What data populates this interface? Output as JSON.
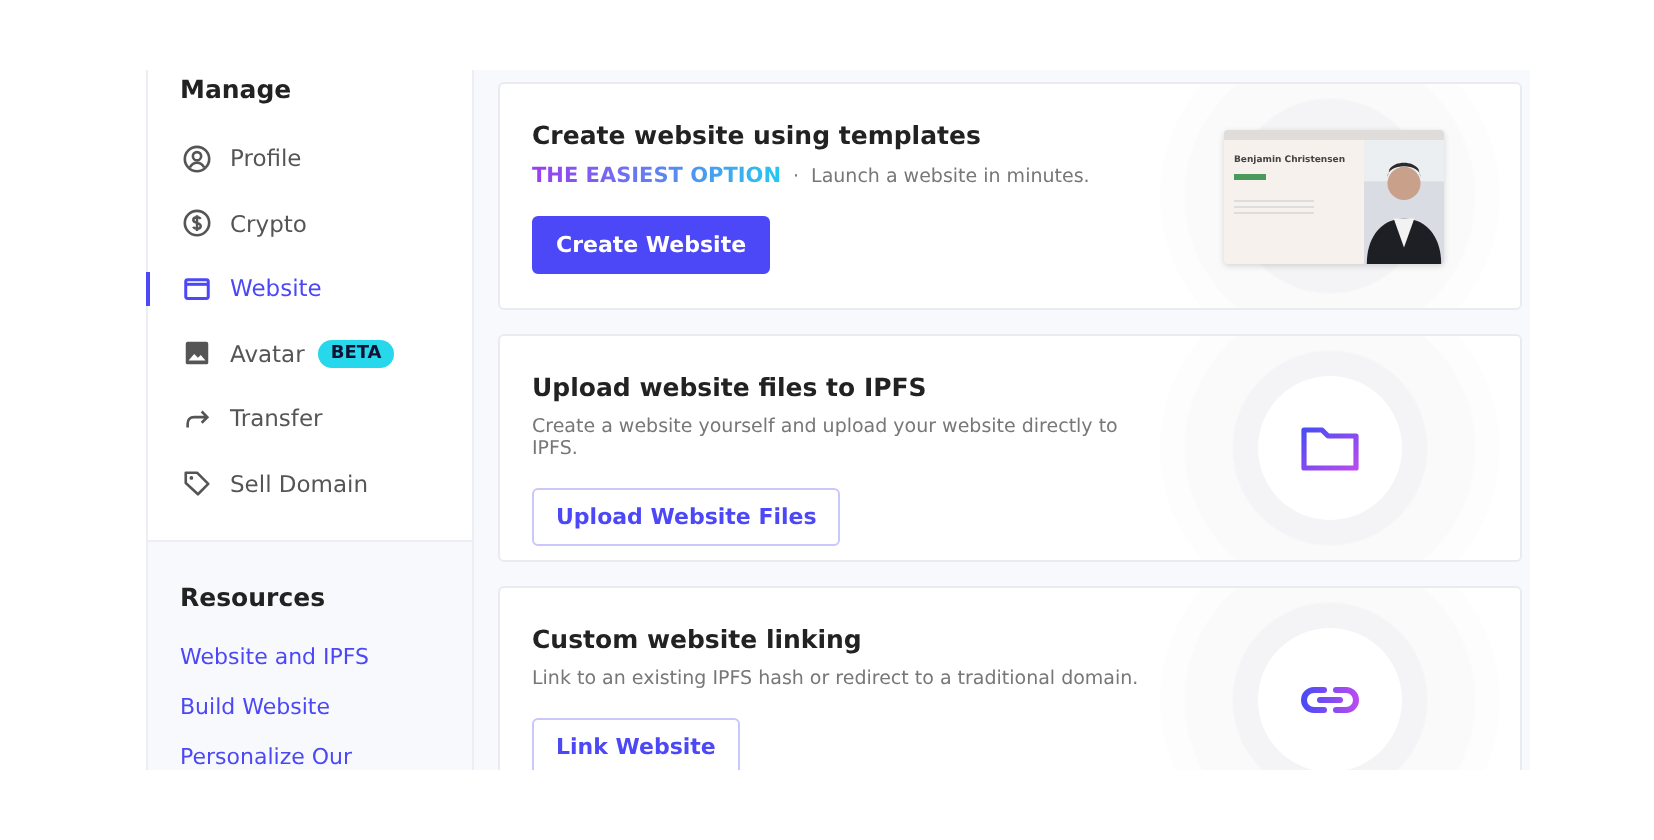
{
  "sidebar": {
    "heading": "Manage",
    "items": [
      {
        "label": "Profile",
        "selected": false
      },
      {
        "label": "Crypto",
        "selected": false
      },
      {
        "label": "Website",
        "selected": true
      },
      {
        "label": "Avatar",
        "selected": false,
        "badge": "BETA"
      },
      {
        "label": "Transfer",
        "selected": false
      },
      {
        "label": "Sell Domain",
        "selected": false
      }
    ],
    "resources": {
      "heading": "Resources",
      "links": [
        "Website and IPFS",
        "Build Website",
        "Personalize Our"
      ]
    }
  },
  "cards": [
    {
      "kind": "preview",
      "title": "Create website using templates",
      "tag": "THE EASIEST OPTION",
      "separator": "·",
      "description": "Launch a website in minutes.",
      "button": "Create Website",
      "primary": true,
      "preview_name": "Benjamin Christensen"
    },
    {
      "kind": "folder",
      "title": "Upload website files to IPFS",
      "description": "Create a website yourself and upload your website directly to IPFS.",
      "button": "Upload Website Files",
      "primary": false
    },
    {
      "kind": "link",
      "title": "Custom website linking",
      "description": "Link to an existing IPFS hash or redirect to a traditional domain.",
      "button": "Link Website",
      "primary": false
    }
  ]
}
